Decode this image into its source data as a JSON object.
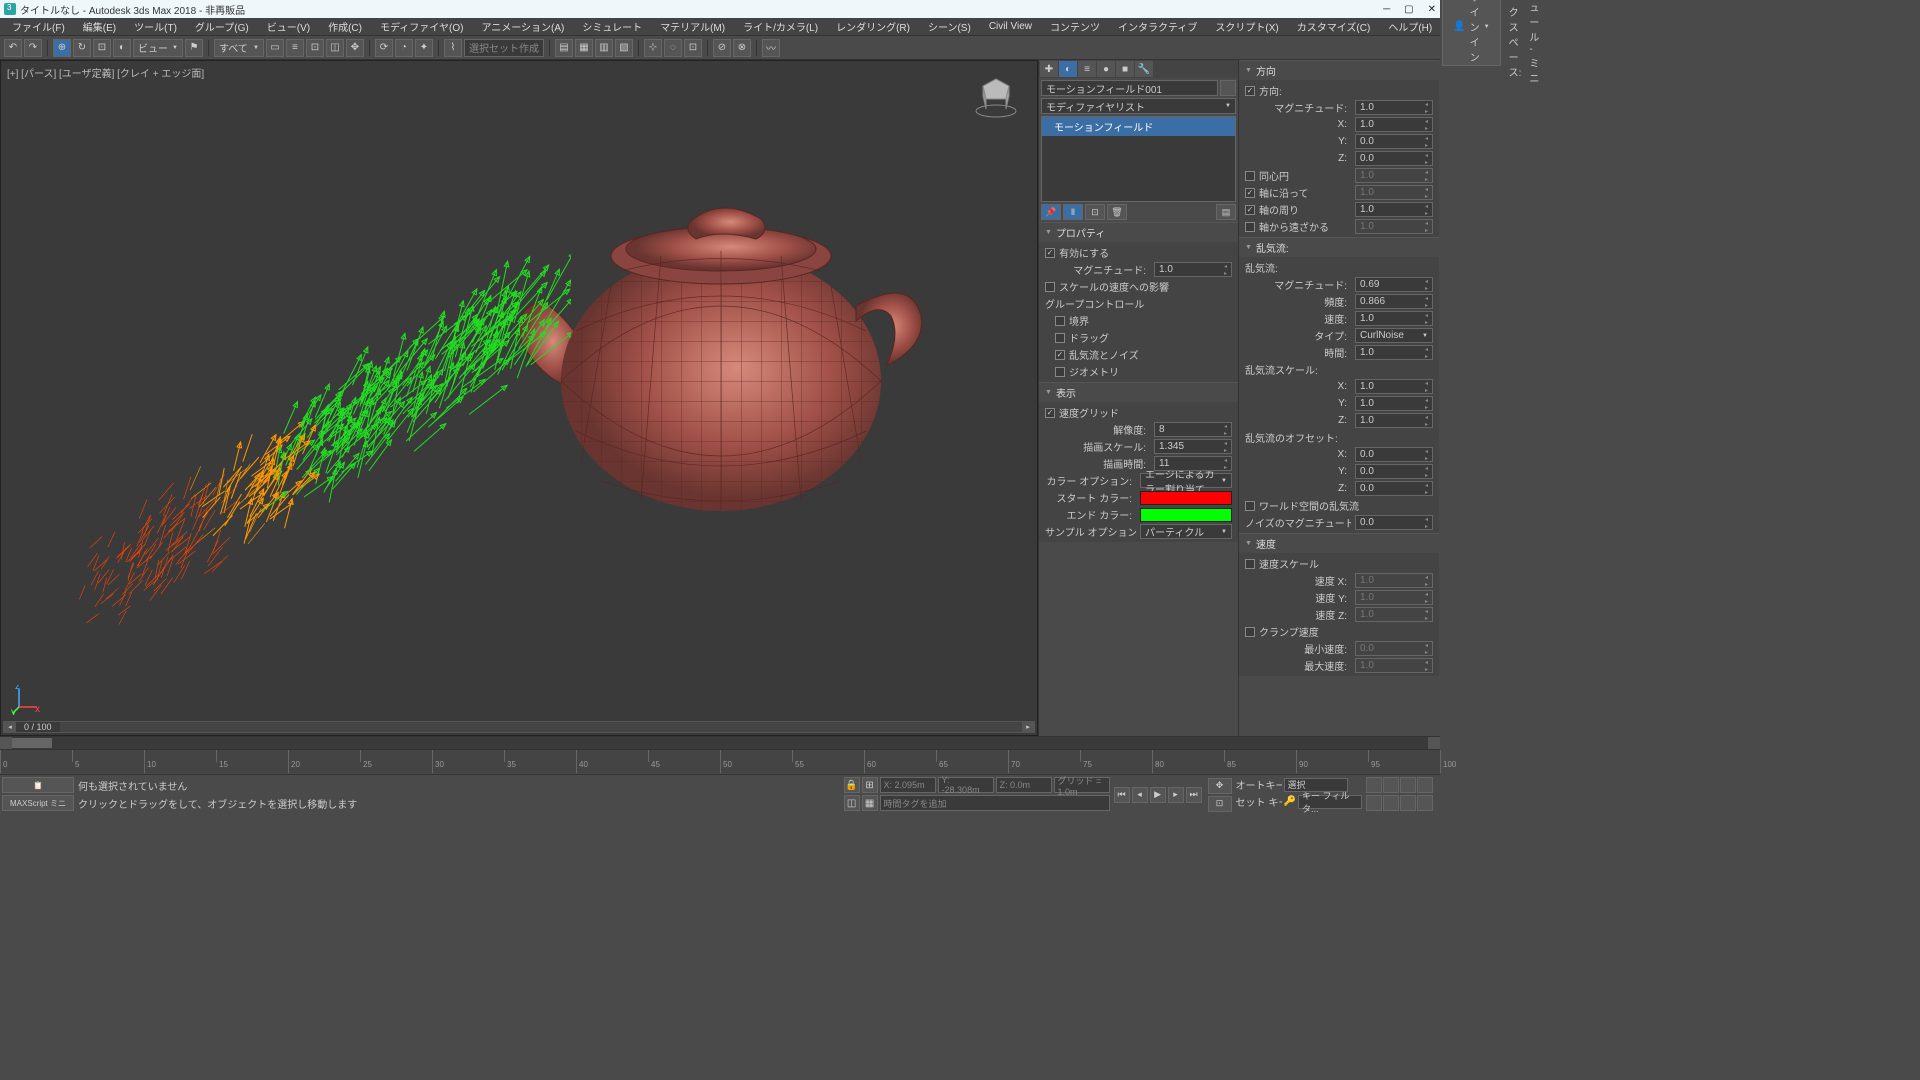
{
  "title": "タイトルなし - Autodesk 3ds Max 2018  - 非再販品",
  "menubar": [
    "ファイル(F)",
    "編集(E)",
    "ツール(T)",
    "グループ(G)",
    "ビュー(V)",
    "作成(C)",
    "モディファイヤ(O)",
    "アニメーション(A)",
    "シミュレート",
    "マテリアル(M)",
    "ライト/カメラ(L)",
    "レンダリング(R)",
    "シーン(S)",
    "Civil View",
    "コンテンツ",
    "インタラクティブ",
    "スクリプト(X)",
    "カスタマイズ(C)",
    "ヘルプ(H)"
  ],
  "signin": "サインイン",
  "workspace_label": "ワークスペース:",
  "workspace_value": "モジュール - ミニ",
  "toolbar": {
    "view_drop": "ビュー",
    "all_drop": "すべて",
    "selset_ph": "選択セット作成"
  },
  "viewport_label": "[+] [パース] [ユーザ定義] [クレイ  + エッジ面]",
  "frame_label": "0 / 100",
  "cmd_panel": {
    "obj_name": "モーションフィールド001",
    "mod_list": "モディファイヤリスト",
    "mod_item": "モーションフィールド"
  },
  "roll_property": {
    "head": "プロパティ",
    "enable": "有効にする",
    "magnitude_lab": "マグニチュード:",
    "magnitude_val": "1.0",
    "scale_vel": "スケールの速度への影響",
    "group_ctrl": "グループコントロール",
    "boundary": "境界",
    "drag": "ドラッグ",
    "turb_noise": "乱気流とノイズ",
    "geometry": "ジオメトリ"
  },
  "roll_display": {
    "head": "表示",
    "vel_grid": "速度グリッド",
    "resolution_lab": "解像度:",
    "resolution_val": "8",
    "draw_scale_lab": "描画スケール:",
    "draw_scale_val": "1.345",
    "draw_time_lab": "描画時間:",
    "draw_time_val": "11",
    "color_opt_lab": "カラー オプション:",
    "color_opt_val": "エージによるカラー割り当て",
    "start_color_lab": "スタート カラー:",
    "end_color_lab": "エンド カラー:",
    "sample_opt_lab": "サンプル オプション:",
    "sample_opt_val": "パーティクル"
  },
  "roll_direction": {
    "head": "方向",
    "dir_lab": "方向:",
    "magnitude_lab": "マグニチュード:",
    "magnitude_val": "1.0",
    "x_lab": "X:",
    "x_val": "1.0",
    "y_lab": "Y:",
    "y_val": "0.0",
    "z_lab": "Z:",
    "z_val": "0.0",
    "concentric": "同心円",
    "along_axis": "軸に沿って",
    "along_axis_val": "1.0",
    "around_axis": "軸の周り",
    "around_axis_val": "1.0",
    "away_axis": "軸から遠ざかる",
    "away_axis_val": "1.0"
  },
  "roll_turb": {
    "head": "乱気流:",
    "turb_lab": "乱気流:",
    "mag_lab": "マグニチュード:",
    "mag_val": "0.69",
    "freq_lab": "頻度:",
    "freq_val": "0.866",
    "speed_lab": "速度:",
    "speed_val": "1.0",
    "type_lab": "タイプ:",
    "type_val": "CurlNoise",
    "time_lab": "時間:",
    "time_val": "1.0",
    "scale_head": "乱気流スケール:",
    "sx": "X:",
    "sx_v": "1.0",
    "sy": "Y:",
    "sy_v": "1.0",
    "sz": "Z:",
    "sz_v": "1.0",
    "offset_head": "乱気流のオフセット:",
    "ox": "X:",
    "ox_v": "0.0",
    "oy": "Y:",
    "oy_v": "0.0",
    "oz": "Z:",
    "oz_v": "0.0",
    "world": "ワールド空間の乱気流",
    "noise_mag_lab": "ノイズのマグニチュード:",
    "noise_mag_val": "0.0"
  },
  "roll_speed": {
    "head": "速度",
    "speed_scale": "速度スケール",
    "vx": "速度 X:",
    "vx_v": "1.0",
    "vy": "速度 Y:",
    "vy_v": "1.0",
    "vz": "速度 Z:",
    "vz_v": "1.0",
    "clamp": "クランプ速度",
    "min_lab": "最小速度:",
    "min_val": "0.0",
    "max_lab": "最大速度:",
    "max_val": "1.0"
  },
  "status": {
    "msg1": "何も選択されていません",
    "msg2": "クリックとドラッグをして、オブジェクトを選択し移動します",
    "maxscript": "MAXScript ミニ",
    "x": "X: 2.095m",
    "y": "Y: -28.308m",
    "z": "Z: 0.0m",
    "grid": "グリッド = 1.0m",
    "timetag": "時間タグを追加",
    "autokey": "オートキー",
    "setkey": "セット キー",
    "sel": "選択",
    "keyfilt": "キー フィルタ..."
  },
  "ticks": [
    0,
    10,
    20,
    30,
    40,
    50,
    60,
    70,
    80,
    90,
    100
  ],
  "tickminor": [
    5,
    15,
    25,
    35,
    45,
    55,
    65,
    75,
    85,
    95
  ]
}
